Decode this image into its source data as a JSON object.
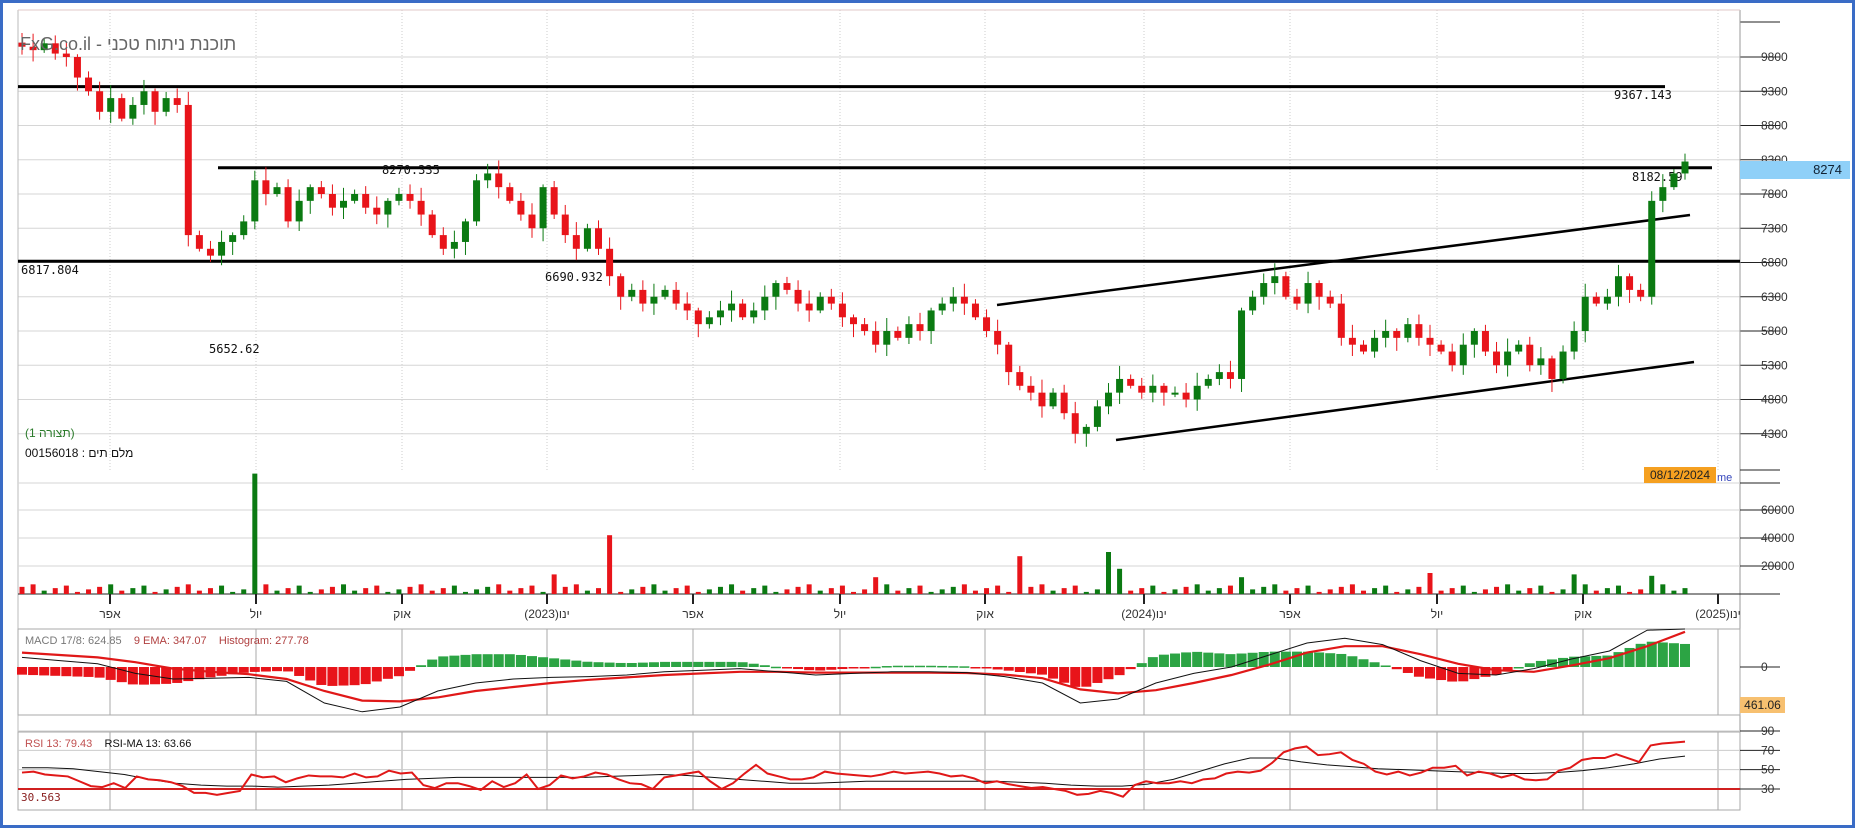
{
  "header": {
    "title": "תוכנת ניתוח טכני - FxG.co.il"
  },
  "info": {
    "pattern_label": "(תצורה 1)",
    "symbol_label": "מלם תים : 00156018"
  },
  "cursor": {
    "date": "08/12/2024",
    "suffix": "me",
    "price": "8274",
    "macd_value": "461.06",
    "rsi_value": "30.563"
  },
  "colors": {
    "up": "#0b7a12",
    "down": "#e8141a",
    "histo_up": "#2ca444",
    "price_box": "#8fd0f8",
    "date_box": "#f5a020",
    "frame": "#3a6cc6"
  },
  "chart_data": [
    {
      "type": "candlestick",
      "title": "Price",
      "ylim": [
        4000,
        10300
      ],
      "yticks": [
        "9800",
        "9300",
        "8800",
        "8300",
        "7800",
        "7300",
        "6800",
        "6300",
        "5800",
        "5300",
        "4800",
        "4300"
      ],
      "closes": [
        9950,
        9900,
        10000,
        9850,
        9800,
        9500,
        9300,
        9000,
        9200,
        8900,
        9100,
        9300,
        9000,
        9200,
        9100,
        7200,
        7000,
        6900,
        7100,
        7200,
        7400,
        8000,
        7800,
        7900,
        7400,
        7700,
        7900,
        7800,
        7600,
        7700,
        7800,
        7600,
        7500,
        7700,
        7800,
        7700,
        7500,
        7200,
        7000,
        7100,
        7400,
        8000,
        8100,
        7900,
        7700,
        7500,
        7300,
        7900,
        7500,
        7200,
        7000,
        7300,
        7000,
        6600,
        6300,
        6400,
        6200,
        6300,
        6400,
        6200,
        6100,
        5900,
        6000,
        6100,
        6200,
        6000,
        6100,
        6300,
        6500,
        6400,
        6200,
        6100,
        6300,
        6200,
        6000,
        5900,
        5800,
        5600,
        5800,
        5700,
        5900,
        5800,
        6100,
        6200,
        6300,
        6200,
        6000,
        5800,
        5600,
        5200,
        5000,
        4900,
        4700,
        4900,
        4600,
        4300,
        4400,
        4700,
        4900,
        5100,
        5000,
        4900,
        5000,
        4900,
        4900,
        4800,
        5000,
        5100,
        5200,
        5100,
        6100,
        6300,
        6500,
        6600,
        6300,
        6200,
        6500,
        6300,
        6200,
        5700,
        5600,
        5500,
        5700,
        5800,
        5700,
        5900,
        5700,
        5600,
        5500,
        5300,
        5600,
        5800,
        5500,
        5300,
        5500,
        5600,
        5300,
        5400,
        5100,
        5500,
        5800,
        6300,
        6200,
        6300,
        6600,
        6400,
        6300,
        7700,
        7900,
        8100,
        8274
      ],
      "annotations": [
        {
          "label": "9367.143",
          "price": 9367.143
        },
        {
          "label": "8270.335",
          "price": 8270.335
        },
        {
          "label": "8182.59",
          "price": 8182.59
        },
        {
          "label": "6817.804",
          "price": 6817.804
        },
        {
          "label": "6690.932",
          "price": 6690.932
        },
        {
          "label": "5652.62",
          "price": 5652.62
        }
      ],
      "xticks": [
        "אפר",
        "יול",
        "אוק",
        "ינו(2023)",
        "אפר",
        "יול",
        "אוק",
        "ינו(2024)",
        "אפר",
        "יול",
        "אוק",
        "ינו(2025)"
      ]
    },
    {
      "type": "bar",
      "title": "Volume",
      "yticks": [
        "60000",
        "40000",
        "20000"
      ],
      "ylim": [
        0,
        90000
      ],
      "spikes": {
        "21": 86000,
        "48": 14000,
        "53": 42000,
        "77": 12000,
        "90": 27000,
        "98": 30000,
        "99": 18000,
        "110": 12000,
        "127": 15000,
        "140": 14000,
        "147": 13000
      }
    },
    {
      "type": "line",
      "title": "MACD",
      "legend": {
        "macd": "MACD 17/8: 624.85",
        "ema": "9 EMA: 347.07",
        "histogram": "Histogram: 277.78"
      },
      "yticks": [
        "0"
      ],
      "macd": [
        120,
        80,
        40,
        -80,
        -150,
        -140,
        -130,
        -180,
        -450,
        -560,
        -500,
        -300,
        -200,
        -150,
        -130,
        -120,
        -100,
        -60,
        -40,
        -20,
        -60,
        -100,
        -80,
        -60,
        -60,
        -70,
        -120,
        -200,
        -450,
        -400,
        -200,
        -80,
        0,
        150,
        300,
        360,
        280,
        80,
        -80,
        -100,
        -20,
        100,
        200,
        460,
        620
      ],
      "signal": [
        180,
        150,
        120,
        60,
        -20,
        -60,
        -90,
        -150,
        -300,
        -420,
        -430,
        -380,
        -300,
        -250,
        -200,
        -160,
        -130,
        -100,
        -80,
        -60,
        -60,
        -70,
        -70,
        -70,
        -70,
        -75,
        -95,
        -140,
        -280,
        -330,
        -290,
        -200,
        -100,
        30,
        180,
        260,
        260,
        160,
        40,
        -40,
        -60,
        20,
        110,
        260,
        440
      ]
    },
    {
      "type": "line",
      "title": "RSI",
      "legend": {
        "rsi": "RSI 13: 79.43",
        "rsi_ma": "RSI-MA 13: 63.66"
      },
      "yticks": [
        "90",
        "70",
        "50",
        "30"
      ],
      "rsi": [
        47,
        48,
        45,
        44,
        43,
        38,
        33,
        32,
        36,
        31,
        43,
        40,
        39,
        37,
        33,
        26,
        26,
        24,
        26,
        28,
        45,
        42,
        43,
        37,
        41,
        44,
        43,
        43,
        42,
        46,
        42,
        43,
        49,
        46,
        47,
        34,
        31,
        36,
        36,
        33,
        29,
        38,
        32,
        36,
        45,
        30,
        34,
        44,
        41,
        43,
        47,
        45,
        40,
        36,
        35,
        30,
        42,
        44,
        46,
        48,
        38,
        30,
        36,
        46,
        55,
        46,
        43,
        40,
        40,
        42,
        48,
        46,
        45,
        44,
        43,
        45,
        48,
        46,
        47,
        48,
        46,
        43,
        44,
        41,
        36,
        38,
        35,
        33,
        31,
        32,
        30,
        28,
        24,
        25,
        28,
        26,
        22,
        34,
        38,
        36,
        36,
        38,
        36,
        40,
        41,
        46,
        48,
        47,
        49,
        57,
        68,
        72,
        74,
        65,
        66,
        68,
        60,
        56,
        48,
        45,
        48,
        44,
        47,
        52,
        52,
        54,
        44,
        48,
        46,
        42,
        45,
        40,
        39,
        40,
        49,
        52,
        60,
        62,
        62,
        66,
        62,
        58,
        75,
        77,
        78,
        79
      ],
      "rsi_ma": [
        52,
        52,
        51,
        48,
        45,
        40,
        36,
        34,
        33,
        33,
        32,
        33,
        34,
        36,
        38,
        40,
        41,
        42,
        42,
        42,
        42,
        42,
        42,
        43,
        44,
        45,
        44,
        42,
        40,
        38,
        36,
        36,
        37,
        38,
        38,
        38,
        38,
        38,
        38,
        37,
        36,
        34,
        33,
        33,
        35,
        40,
        48,
        56,
        62,
        62,
        58,
        55,
        53,
        51,
        50,
        49,
        48,
        47,
        46,
        46,
        47,
        49,
        52,
        56,
        61,
        64
      ]
    }
  ]
}
